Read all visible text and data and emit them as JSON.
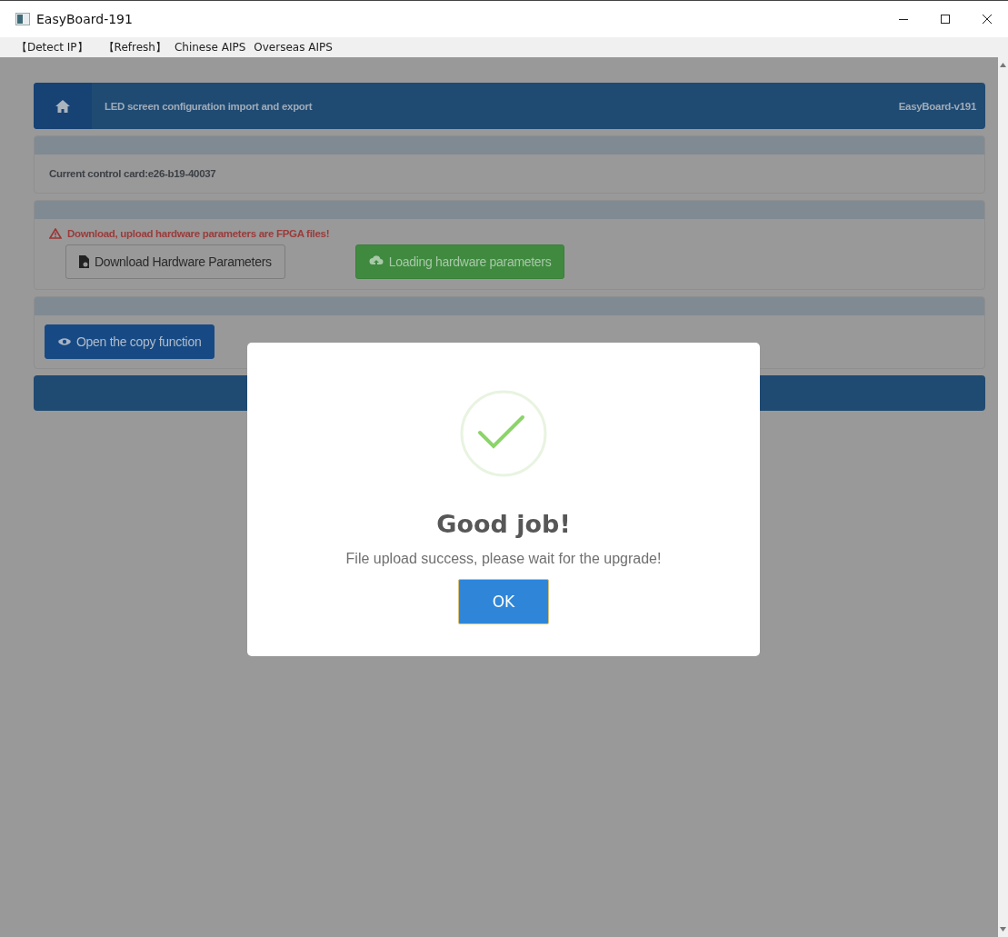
{
  "window": {
    "title": "EasyBoard-191"
  },
  "menu": [
    {
      "label": "【Detect IP】"
    },
    {
      "label": "【Refresh】"
    },
    {
      "label": "Chinese AIPS"
    },
    {
      "label": "Overseas AIPS"
    }
  ],
  "header": {
    "title": "LED screen configuration import and export",
    "version": "EasyBoard-v191"
  },
  "card_panel": {
    "text": "Current control card:e26-b19-40037"
  },
  "hardware_panel": {
    "warning": "Download, upload hardware parameters are FPGA files!",
    "buttons": [
      {
        "label": "Download Hardware Parameters",
        "kind": "default"
      },
      {
        "label": "Loading hardware parameters",
        "kind": "success"
      }
    ]
  },
  "copy_panel": {
    "button": {
      "label": "Open the copy function"
    }
  },
  "dialog": {
    "title": "Good job!",
    "message": "File upload success, please wait for the upgrade!",
    "button": "OK"
  }
}
